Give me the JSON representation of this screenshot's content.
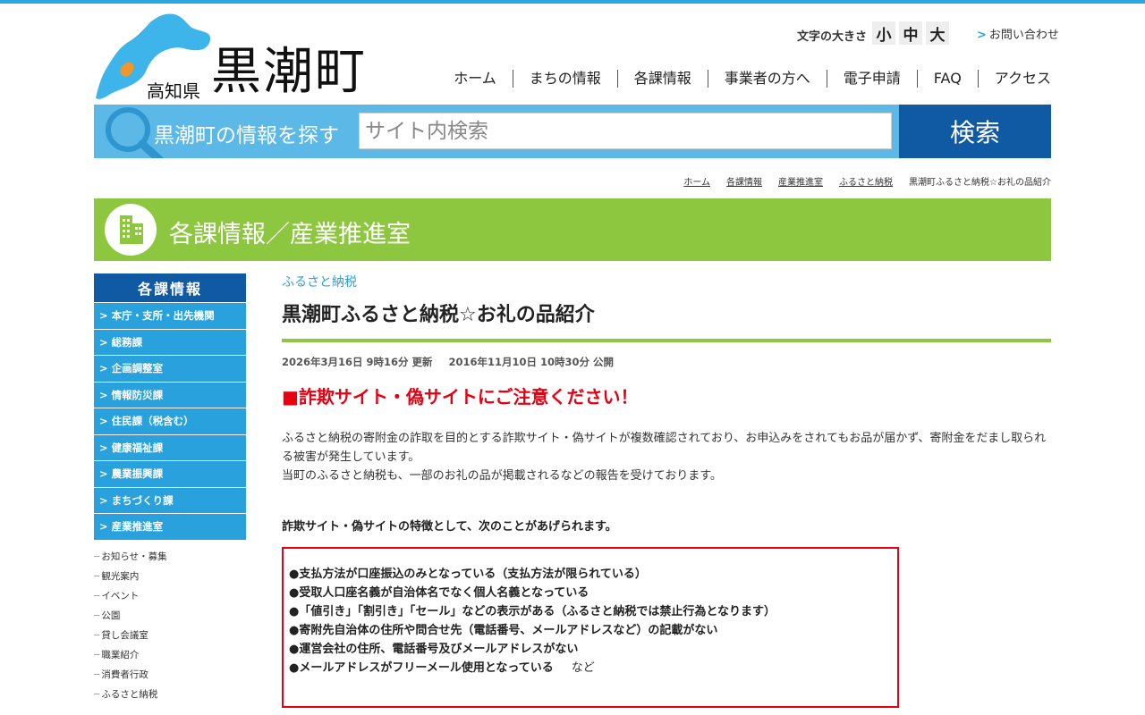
{
  "header": {
    "prefecture": "高知県",
    "town": "黒潮町",
    "font_size_label": "文字の大きさ",
    "font_sizes": [
      "小",
      "中",
      "大"
    ],
    "contact": "お問い合わせ"
  },
  "nav": [
    "ホーム",
    "まちの情報",
    "各課情報",
    "事業者の方へ",
    "電子申請",
    "FAQ",
    "アクセス"
  ],
  "search": {
    "label": "黒潮町の情報を探す",
    "placeholder": "サイト内検索",
    "button": "検索"
  },
  "breadcrumb": [
    "ホーム",
    "各課情報",
    "産業推進室",
    "ふるさと納税",
    "黒潮町ふるさと納税☆お礼の品紹介"
  ],
  "banner": {
    "title": "各課情報／産業推進室"
  },
  "sidebar": {
    "heading": "各課情報",
    "items": [
      "本庁・支所・出先機関",
      "総務課",
      "企画調整室",
      "情報防災課",
      "住民課（税含む）",
      "健康福祉課",
      "農業振興課",
      "まちづくり課",
      "産業推進室"
    ],
    "subitems": [
      "お知らせ・募集",
      "観光案内",
      "イベント",
      "公園",
      "貸し会議室",
      "職業紹介",
      "消費者行政",
      "ふるさと納税"
    ]
  },
  "article": {
    "category": "ふるさと納税",
    "title": "黒潮町ふるさと納税☆お礼の品紹介",
    "updated": "2026年3月16日 9時16分 更新",
    "published": "2016年11月10日 10時30分 公開",
    "warning": "■詐欺サイト・偽サイトにご注意ください！",
    "para1": "ふるさと納税の寄附金の詐取を目的とする詐欺サイト・偽サイトが複数確認されており、お申込みをされてもお品が届かず、寄附金をだまし取られる被害が発生しています。",
    "para2": "当町のふるさと納税も、一部のお礼の品が掲載されるなどの報告を受けております。",
    "subheading": "詐欺サイト・偽サイトの特徴として、次のことがあげられます。",
    "features": [
      "●支払方法が口座振込のみとなっている（支払方法が限られている）",
      "●受取人口座名義が自治体名でなく個人名義となっている",
      "●「値引き」「割引き」「セール」などの表示がある（ふるさと納税では禁止行為となります）",
      "●寄附先自治体の住所や問合せ先（電話番号、メールアドレスなど）の記載がない",
      "●運営会社の住所、電話番号及びメールアドレスがない",
      "●メールアドレスがフリーメール使用となっている"
    ],
    "features_tail": "など"
  },
  "colors": {
    "accent_blue": "#29a1dc",
    "dark_blue": "#1059a3",
    "green": "#8dc63f",
    "warning_red": "#e60012"
  }
}
